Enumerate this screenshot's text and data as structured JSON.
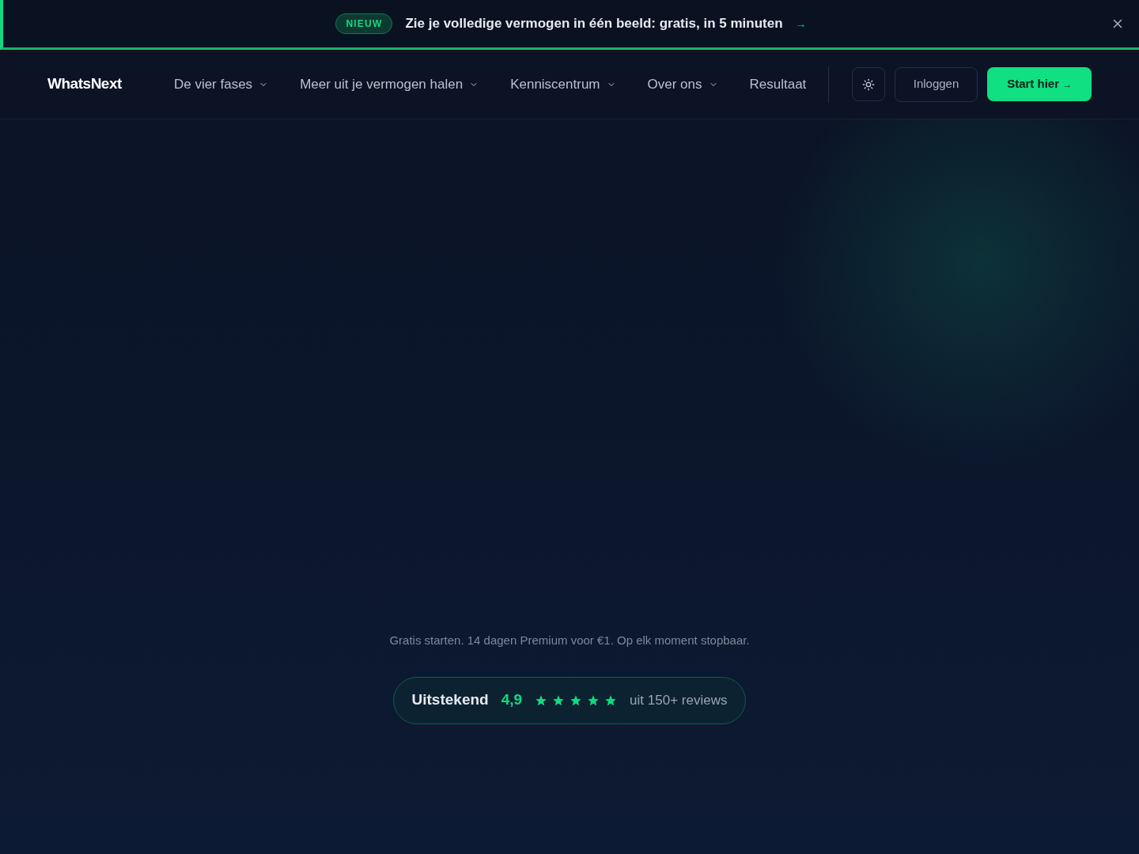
{
  "banner": {
    "badge": "NIEUW",
    "text": "Zie je volledige vermogen in één beeld: gratis, in 5 minuten",
    "arrow": "→"
  },
  "nav": {
    "logo": "WhatsNext",
    "items": [
      {
        "label": "De vier fases",
        "dropdown": true
      },
      {
        "label": "Meer uit je vermogen halen",
        "dropdown": true
      },
      {
        "label": "Kenniscentrum",
        "dropdown": true
      },
      {
        "label": "Over ons",
        "dropdown": true
      },
      {
        "label": "Resultaat",
        "dropdown": false
      }
    ],
    "login": "Inloggen",
    "cta": {
      "label": "Start hier",
      "arrow": "→"
    }
  },
  "hero": {
    "note": "Gratis starten. 14 dagen Premium voor €1. Op elk moment stopbaar.",
    "rating": {
      "label": "Uitstekend",
      "score": "4,9",
      "stars": 5,
      "reviews": "uit 150+ reviews"
    }
  }
}
